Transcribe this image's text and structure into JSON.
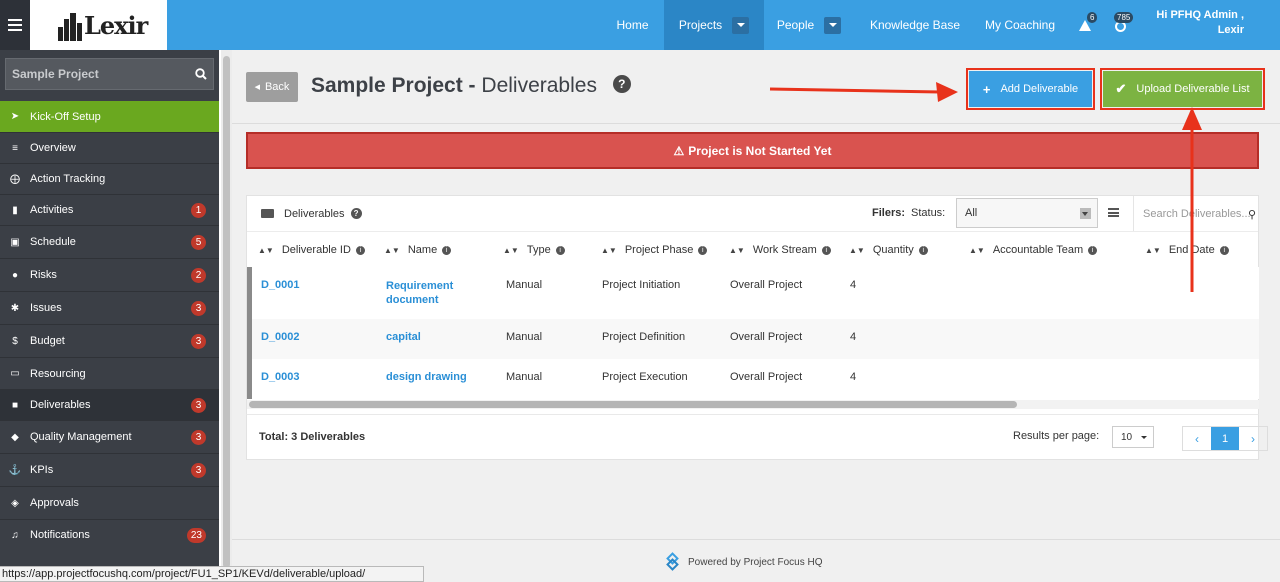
{
  "topbar": {
    "logo": "Lexir",
    "nav": [
      {
        "label": "Home"
      },
      {
        "label": "Projects"
      },
      {
        "label": "People"
      },
      {
        "label": "Knowledge Base"
      },
      {
        "label": "My Coaching"
      }
    ],
    "alerts_count": "6",
    "notifications_count": "785",
    "user_greeting": "Hi PFHQ Admin ,",
    "user_org": "Lexir"
  },
  "sidebar": {
    "search_value": "Sample Project",
    "items": [
      {
        "label": "Kick-Off Setup",
        "icon": "rocket-icon",
        "badge": ""
      },
      {
        "label": "Overview",
        "icon": "list-icon",
        "badge": ""
      },
      {
        "label": "Action Tracking",
        "icon": "crosshair-icon",
        "badge": ""
      },
      {
        "label": "Activities",
        "icon": "bookmark-icon",
        "badge": "1"
      },
      {
        "label": "Schedule",
        "icon": "calendar-icon",
        "badge": "5"
      },
      {
        "label": "Risks",
        "icon": "lightbulb-icon",
        "badge": "2"
      },
      {
        "label": "Issues",
        "icon": "bug-icon",
        "badge": "3"
      },
      {
        "label": "Budget",
        "icon": "dollar-icon",
        "badge": "3"
      },
      {
        "label": "Resourcing",
        "icon": "folder-icon",
        "badge": ""
      },
      {
        "label": "Deliverables",
        "icon": "truck-icon",
        "badge": "3"
      },
      {
        "label": "Quality Management",
        "icon": "tag-icon",
        "badge": "3"
      },
      {
        "label": "KPIs",
        "icon": "anchor-icon",
        "badge": "3"
      },
      {
        "label": "Approvals",
        "icon": "gavel-icon",
        "badge": ""
      },
      {
        "label": "Notifications",
        "icon": "bell-icon",
        "badge": "23"
      }
    ]
  },
  "main": {
    "back_label": "Back",
    "title_bold": "Sample Project -",
    "title_rest": "Deliverables",
    "add_button": "Add Deliverable",
    "upload_button": "Upload Deliverable List",
    "alert": "Project is Not Started Yet",
    "panel_title": "Deliverables",
    "filters_label": "Filers:",
    "status_label": "Status:",
    "status_value": "All",
    "search_placeholder": "Search Deliverables...",
    "columns": [
      "Deliverable ID",
      "Name",
      "Type",
      "Project Phase",
      "Work Stream",
      "Quantity",
      "Accountable Team",
      "End Date"
    ],
    "rows": [
      {
        "id": "D_0001",
        "name_line1": "Requirement",
        "name_line2": "document",
        "type": "Manual",
        "phase": "Project Initiation",
        "stream": "Overall Project",
        "qty": "4"
      },
      {
        "id": "D_0002",
        "name_line1": "capital",
        "name_line2": "",
        "type": "Manual",
        "phase": "Project Definition",
        "stream": "Overall Project",
        "qty": "4"
      },
      {
        "id": "D_0003",
        "name_line1": "design drawing",
        "name_line2": "",
        "type": "Manual",
        "phase": "Project Execution",
        "stream": "Overall Project",
        "qty": "4"
      }
    ],
    "total": "Total: 3 Deliverables",
    "rpp_label": "Results per page:",
    "rpp_value": "10",
    "current_page": "1",
    "powered_by": "Powered by Project Focus HQ"
  },
  "statusbar_url": "https://app.projectfocushq.com/project/FU1_SP1/KEVd/deliverable/upload/",
  "colors": {
    "accent": "#3a9fe2",
    "green": "#7cb342",
    "alert": "#d9534f",
    "annotation": "#e8321b"
  }
}
